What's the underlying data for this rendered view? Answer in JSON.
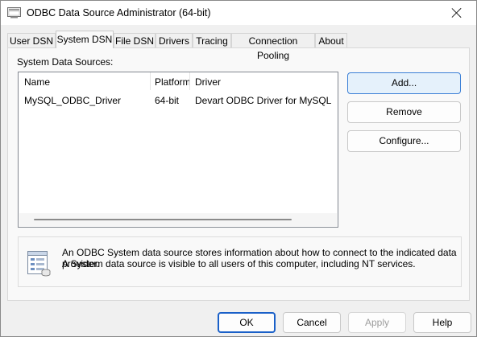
{
  "window": {
    "title": "ODBC Data Source Administrator (64-bit)"
  },
  "tabs": [
    {
      "label": "User DSN"
    },
    {
      "label": "System DSN"
    },
    {
      "label": "File DSN"
    },
    {
      "label": "Drivers"
    },
    {
      "label": "Tracing"
    },
    {
      "label": "Connection Pooling"
    },
    {
      "label": "About"
    }
  ],
  "active_tab": "System DSN",
  "system_dsn": {
    "section_label": "System Data Sources:",
    "columns": [
      "Name",
      "Platform",
      "Driver"
    ],
    "rows": [
      {
        "name": "MySQL_ODBC_Driver",
        "platform": "64-bit",
        "driver": "Devart ODBC Driver for MySQL"
      }
    ],
    "buttons": {
      "add": "Add...",
      "remove": "Remove",
      "configure": "Configure..."
    },
    "info": {
      "line1": "An ODBC System data source stores information about how to connect to the indicated data provider.",
      "line2": "A System data source is visible to all users of this computer, including NT services."
    }
  },
  "footer": {
    "ok": "OK",
    "cancel": "Cancel",
    "apply": "Apply",
    "help": "Help"
  },
  "icons": {
    "app": "odbc-admin-icon",
    "close": "close-icon",
    "info": "database-info-icon"
  }
}
